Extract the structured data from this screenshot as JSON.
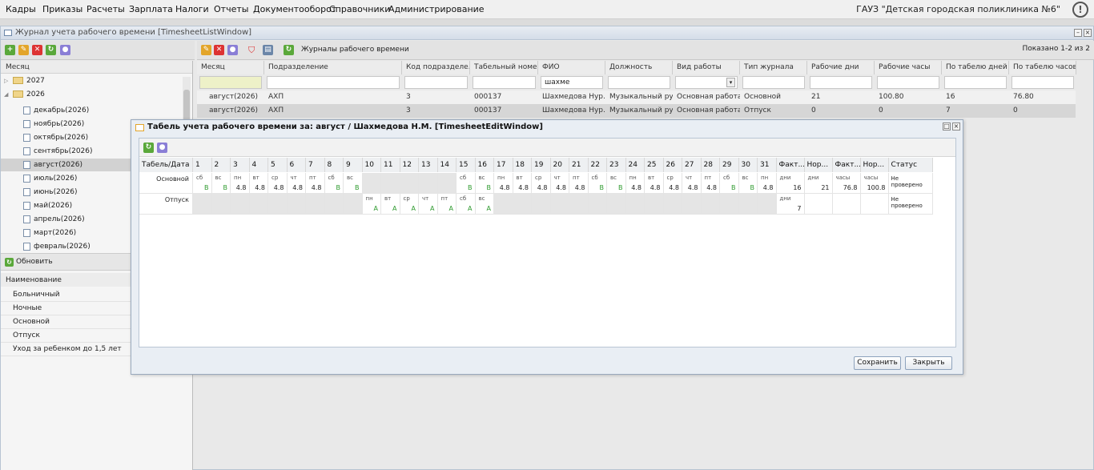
{
  "menu": [
    "Кадры",
    "Приказы",
    "Расчеты",
    "Зарплата",
    "Налоги",
    "Отчеты",
    "Документооборот",
    "Справочники",
    "Администрирование"
  ],
  "org": "ГАУЗ \"Детская городская поликлиника №6\"",
  "warn_icon": "!",
  "main_title": "Журнал учета рабочего времени [TimesheetListWindow]",
  "left": {
    "col": "Месяц",
    "tree": [
      "2027",
      "2026"
    ],
    "months": [
      "декабрь(2026)",
      "ноябрь(2026)",
      "октябрь(2026)",
      "сентябрь(2026)",
      "август(2026)",
      "июль(2026)",
      "июнь(2026)",
      "май(2026)",
      "апрель(2026)",
      "март(2026)",
      "февраль(2026)"
    ],
    "refresh": "Обновить",
    "list_head": "Наименование",
    "list": [
      "Больничный",
      "Ночные",
      "Основной",
      "Отпуск",
      "Уход за ребенком до 1,5 лет"
    ]
  },
  "right": {
    "tb_label": "Журналы рабочего времени",
    "shown": "Показано 1-2 из 2",
    "cols": [
      "Месяц",
      "Подразделение",
      "Код подразделе...",
      "Табельный номер",
      "ФИО",
      "Должность",
      "Вид работы",
      "Тип журнала",
      "Рабочие дни",
      "Рабочие часы",
      "По табелю дней",
      "По табелю часов"
    ],
    "filter_fio": "шахме",
    "rows": [
      [
        "август(2026)",
        "АХП",
        "3",
        "000137",
        "Шахмедова Нур...",
        "Музыкальный ру...",
        "Основная работа",
        "Основной",
        "21",
        "100.80",
        "16",
        "76.80"
      ],
      [
        "август(2026)",
        "АХП",
        "3",
        "000137",
        "Шахмедова Нур...",
        "Музыкальный ру...",
        "Основная работа",
        "Отпуск",
        "0",
        "0",
        "7",
        "0"
      ]
    ]
  },
  "modal": {
    "title": "Табель учета рабочего времени за: август / Шахмедова Н.М. [TimesheetEditWindow]",
    "head_first": "Табель/Дата",
    "days": [
      "1",
      "2",
      "3",
      "4",
      "5",
      "6",
      "7",
      "8",
      "9",
      "10",
      "11",
      "12",
      "13",
      "14",
      "15",
      "16",
      "17",
      "18",
      "19",
      "20",
      "21",
      "22",
      "23",
      "24",
      "25",
      "26",
      "27",
      "28",
      "29",
      "30",
      "31"
    ],
    "tail_heads": [
      "Факт...",
      "Нор...",
      "Факт...",
      "Нор...",
      "Статус"
    ],
    "rows": [
      {
        "name": "Основной",
        "cells": [
          [
            "сб",
            "В"
          ],
          [
            "вс",
            "В"
          ],
          [
            "пн",
            "4.8"
          ],
          [
            "вт",
            "4.8"
          ],
          [
            "ср",
            "4.8"
          ],
          [
            "чт",
            "4.8"
          ],
          [
            "пт",
            "4.8"
          ],
          [
            "сб",
            "В"
          ],
          [
            "вс",
            "В"
          ],
          null,
          null,
          null,
          null,
          null,
          [
            "сб",
            "В"
          ],
          [
            "вс",
            "В"
          ],
          [
            "пн",
            "4.8"
          ],
          [
            "вт",
            "4.8"
          ],
          [
            "ср",
            "4.8"
          ],
          [
            "чт",
            "4.8"
          ],
          [
            "пт",
            "4.8"
          ],
          [
            "сб",
            "В"
          ],
          [
            "вс",
            "В"
          ],
          [
            "пн",
            "4.8"
          ],
          [
            "вт",
            "4.8"
          ],
          [
            "ср",
            "4.8"
          ],
          [
            "чт",
            "4.8"
          ],
          [
            "пт",
            "4.8"
          ],
          [
            "сб",
            "В"
          ],
          [
            "вс",
            "В"
          ],
          [
            "пн",
            "4.8"
          ]
        ],
        "tail": [
          [
            "дни",
            "16"
          ],
          [
            "дни",
            "21"
          ],
          [
            "часы",
            "76.8"
          ],
          [
            "часы",
            "100.8"
          ]
        ],
        "status": "Не проверено"
      },
      {
        "name": "Отпуск",
        "cells": [
          null,
          null,
          null,
          null,
          null,
          null,
          null,
          null,
          null,
          [
            "пн",
            "А"
          ],
          [
            "вт",
            "А"
          ],
          [
            "ср",
            "А"
          ],
          [
            "чт",
            "А"
          ],
          [
            "пт",
            "А"
          ],
          [
            "сб",
            "А"
          ],
          [
            "вс",
            "А"
          ],
          null,
          null,
          null,
          null,
          null,
          null,
          null,
          null,
          null,
          null,
          null,
          null,
          null,
          null,
          null
        ],
        "tail": [
          [
            "дни",
            "7"
          ],
          null,
          null,
          null
        ],
        "status": "Не проверено"
      }
    ],
    "save": "Сохранить",
    "close": "Закрыть"
  }
}
